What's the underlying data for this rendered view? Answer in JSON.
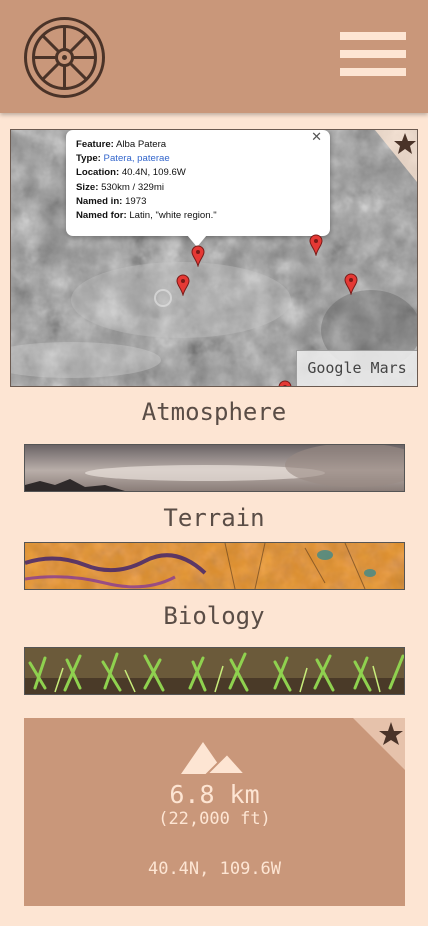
{
  "header": {
    "logo": "ship-wheel-icon",
    "menu": "hamburger-menu-icon"
  },
  "map": {
    "attribution_label": "Google Mars",
    "favorite_icon": "star-icon",
    "popup": {
      "feature_label": "Feature:",
      "feature_value": "Alba Patera",
      "type_label": "Type:",
      "type_value": "Patera, paterae",
      "location_label": "Location:",
      "location_value": "40.4N, 109.6W",
      "size_label": "Size:",
      "size_value": "530km / 329mi",
      "named_in_label": "Named in:",
      "named_in_value": "1973",
      "named_for_label": "Named for:",
      "named_for_value": "Latin, \"white region.\"",
      "close_icon": "close-icon"
    },
    "marker_icon": "map-pin-icon"
  },
  "sections": {
    "atmosphere": "Atmosphere",
    "terrain": "Terrain",
    "biology": "Biology"
  },
  "card": {
    "icon": "mountain-icon",
    "favorite_icon": "star-icon",
    "elevation_km": "6.8 km",
    "elevation_ft": "(22,000 ft)",
    "coordinates": "40.4N, 109.6W"
  },
  "colors": {
    "background": "#fde5d3",
    "accent": "#c9977a",
    "text": "#5a4d46",
    "marker": "#e53935"
  }
}
